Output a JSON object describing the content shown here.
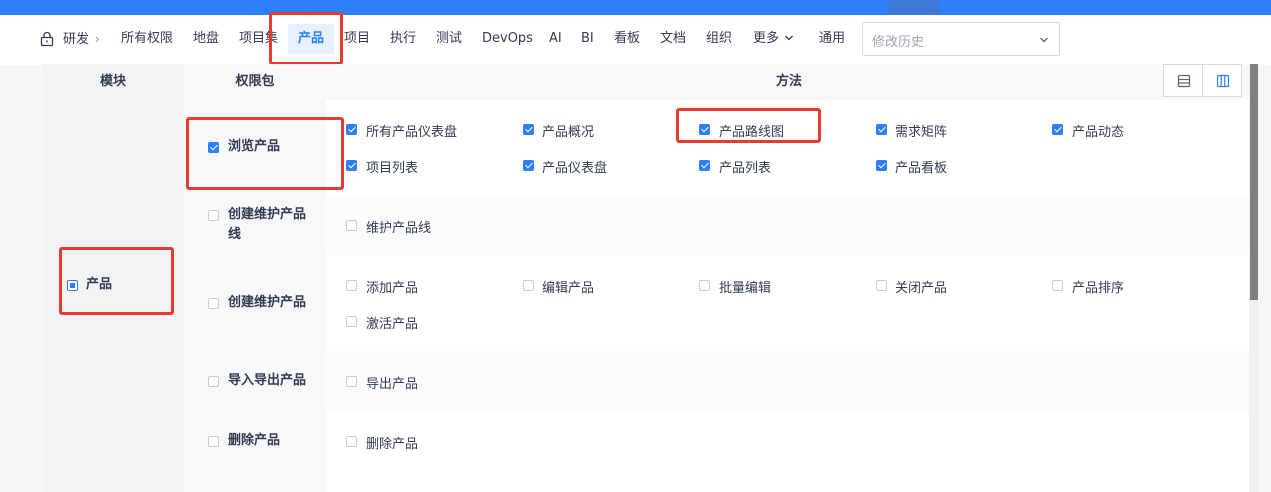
{
  "nav": {
    "breadcrumb": "研发",
    "items": [
      "所有权限",
      "地盘",
      "项目集",
      "产品",
      "项目",
      "执行",
      "测试",
      "DevOps",
      "AI",
      "BI",
      "看板",
      "文档",
      "组织",
      "更多",
      "通用"
    ],
    "active": "产品",
    "select_placeholder": "修改历史"
  },
  "table": {
    "headers": {
      "module": "模块",
      "package": "权限包",
      "method": "方法"
    },
    "module_name": "产品",
    "packages": [
      {
        "name": "浏览产品",
        "checked": true,
        "methods": [
          {
            "label": "所有产品仪表盘",
            "checked": true
          },
          {
            "label": "产品概况",
            "checked": true
          },
          {
            "label": "产品路线图",
            "checked": true
          },
          {
            "label": "需求矩阵",
            "checked": true
          },
          {
            "label": "产品动态",
            "checked": true
          },
          {
            "label": "项目列表",
            "checked": true
          },
          {
            "label": "产品仪表盘",
            "checked": true
          },
          {
            "label": "产品列表",
            "checked": true
          },
          {
            "label": "产品看板",
            "checked": true
          }
        ]
      },
      {
        "name": "创建维护产品线",
        "checked": false,
        "methods": [
          {
            "label": "维护产品线",
            "checked": false
          }
        ]
      },
      {
        "name": "创建维护产品",
        "checked": false,
        "methods": [
          {
            "label": "添加产品",
            "checked": false
          },
          {
            "label": "编辑产品",
            "checked": false
          },
          {
            "label": "批量编辑",
            "checked": false
          },
          {
            "label": "关闭产品",
            "checked": false
          },
          {
            "label": "产品排序",
            "checked": false
          },
          {
            "label": "激活产品",
            "checked": false
          }
        ]
      },
      {
        "name": "导入导出产品",
        "checked": false,
        "methods": [
          {
            "label": "导出产品",
            "checked": false
          }
        ]
      },
      {
        "name": "删除产品",
        "checked": false,
        "methods": [
          {
            "label": "删除产品",
            "checked": false
          }
        ]
      }
    ]
  },
  "colors": {
    "accent": "#2e7ff8",
    "highlight": "#e83a2f"
  }
}
